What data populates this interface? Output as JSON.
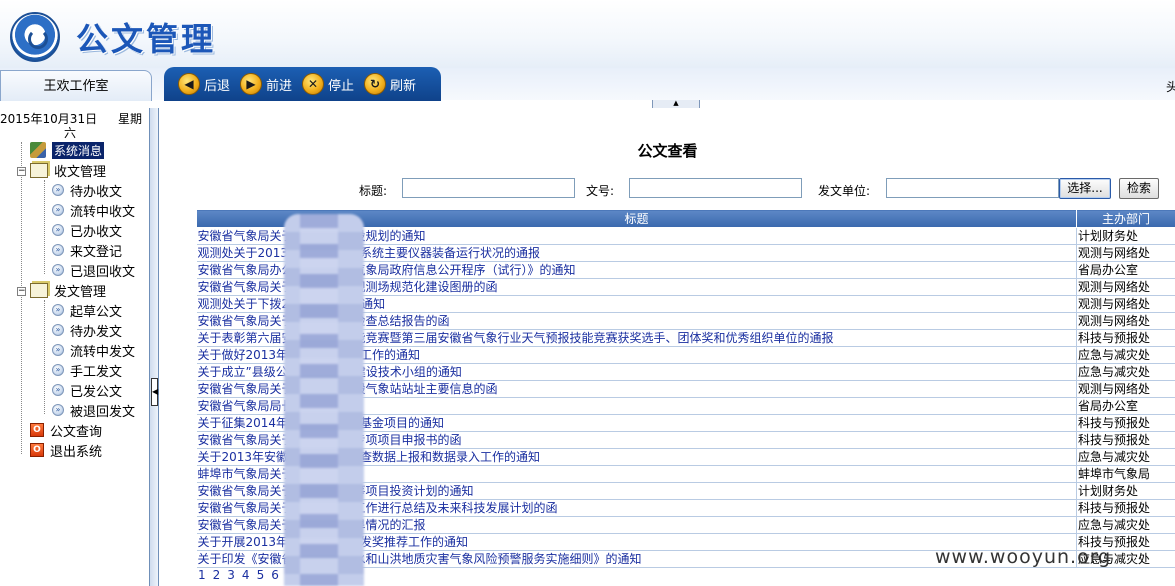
{
  "app": {
    "title": "公文管理"
  },
  "nav": {
    "office_tab": "王欢工作室",
    "toolbar": [
      {
        "icon": "back-icon",
        "glyph": "◀",
        "label": "后退"
      },
      {
        "icon": "forward-icon",
        "glyph": "▶",
        "label": "前进"
      },
      {
        "icon": "stop-icon",
        "glyph": "✕",
        "label": "停止"
      },
      {
        "icon": "refresh-icon",
        "glyph": "↻",
        "label": "刷新"
      }
    ],
    "right_edge_text": "头",
    "collapse_glyph": "▲"
  },
  "sidebar": {
    "date": "2015年10月31日",
    "weekday_prefix": "星期",
    "weekday": "六",
    "tree": {
      "system": "系统消息",
      "inbox": {
        "label": "收文管理",
        "items": [
          "待办收文",
          "流转中收文",
          "已办收文",
          "来文登记",
          "已退回收文"
        ]
      },
      "outbox": {
        "label": "发文管理",
        "items": [
          "起草公文",
          "待办发文",
          "流转中发文",
          "手工发文",
          "已发公文",
          "被退回发文"
        ]
      },
      "query": "公文查询",
      "logout": "退出系统"
    }
  },
  "main": {
    "title": "公文查看",
    "search": {
      "title_label": "标题:",
      "title_value": "",
      "docno_label": "文号:",
      "docno_value": "",
      "unit_label": "发文单位:",
      "unit_value": "",
      "select_button": "选择...",
      "search_button": "检索"
    },
    "table": {
      "columns": [
        "标题",
        "主办部门"
      ],
      "rows": [
        {
          "title": "安徽省气象局关于……台站建设规划的通知",
          "dept": "计划财务处"
        },
        {
          "title": "观测处关于2013……气象观测系统主要仪器装备运行状况的通报",
          "dept": "观测与网络处"
        },
        {
          "title": "安徽省气象局办公……安徽省气象局政府信息公开程序（试行）》的通知",
          "dept": "省局办公室"
        },
        {
          "title": "安徽省气象局关于……面气象观测场规范化建设图册的函",
          "dept": "观测与网络处"
        },
        {
          "title": "观测处关于下拨2……管理费的通知",
          "dept": "观测与网络处"
        },
        {
          "title": "安徽省气象局关于……息安全检查总结报告的函",
          "dept": "观测与网络处"
        },
        {
          "title": "关于表彰第六届安……业务技能竞赛暨第三届安徽省气象行业天气预报技能竞赛获奖选手、团体奖和优秀组织单位的通报",
          "dept": "科技与预报处"
        },
        {
          "title": "关于做好2013年国……象服务工作的通知",
          "dept": "应急与减灾处"
        },
        {
          "title": "关于成立”县级公……务平台”建设技术小组的通知",
          "dept": "应急与减灾处"
        },
        {
          "title": "安徽省气象局关于……国家一般气象站站址主要信息的函",
          "dept": "观测与网络处"
        },
        {
          "title": "安徽省气象局局长……",
          "dept": "省局办公室"
        },
        {
          "title": "关于征集2014年度……技发展基金项目的通知",
          "dept": "科技与预报处"
        },
        {
          "title": "安徽省气象局关于……候变化专项项目申报书的函",
          "dept": "科技与预报处"
        },
        {
          "title": "关于2013年安徽省……风险普查数据上报和数据录入工作的通知",
          "dept": "应急与减灾处"
        },
        {
          "title": "蚌埠市气象局关于……的请示",
          "dept": "蚌埠市气象局"
        },
        {
          "title": "安徽省气象局关于……省级统筹项目投资计划的通知",
          "dept": "计划财务处"
        },
        {
          "title": "安徽省气象局关于……所发展工作进行总结及未来科技发展计划的函",
          "dept": "科技与预报处"
        },
        {
          "title": "安徽省气象局关于……增雨抗旱情况的汇报",
          "dept": "应急与减灾处"
        },
        {
          "title": "关于开展2013年度……科研开发奖推荐工作的通知",
          "dept": "科技与预报处"
        },
        {
          "title": "关于印发《安徽省……河流洪水和山洪地质灾害气象风险预警服务实施细则》的通知",
          "dept": "应急与减灾处"
        }
      ]
    },
    "pager": [
      "1",
      "2",
      "3",
      "4",
      "5",
      "6",
      "7",
      "8",
      "9",
      "10",
      "..."
    ]
  },
  "watermark": "www.wooyun.org"
}
